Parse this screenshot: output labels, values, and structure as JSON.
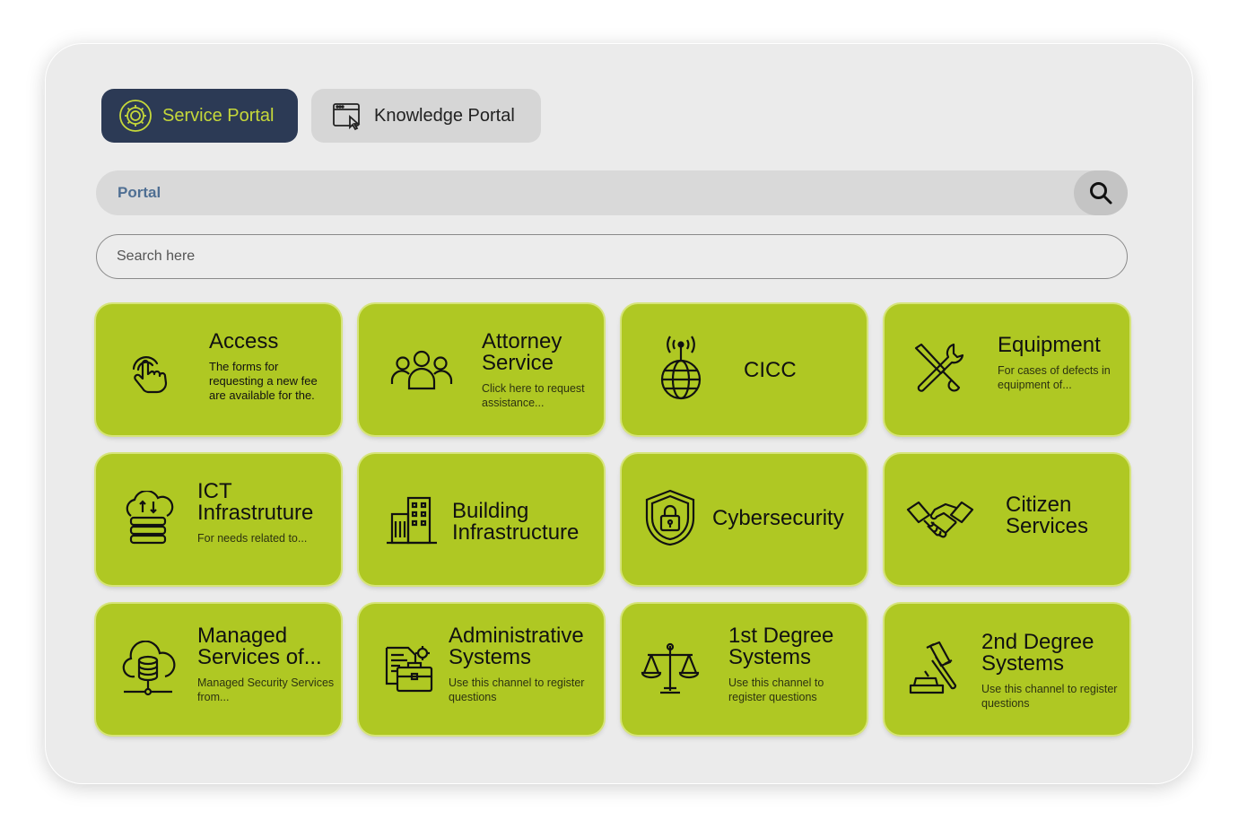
{
  "tabs": [
    {
      "label": "Service Portal",
      "icon": "gear-icon",
      "active": true
    },
    {
      "label": "Knowledge Portal",
      "icon": "browser-cursor-icon",
      "active": false
    }
  ],
  "portal_bar": {
    "label": "Portal",
    "search_icon": "search-icon"
  },
  "search": {
    "placeholder": "Search here"
  },
  "colors": {
    "accent": "#afc823",
    "navy": "#2c3a55",
    "lime_text": "#c6d83a"
  },
  "cards": [
    {
      "title": "Access",
      "desc": "The forms for requesting a new fee are available for the.",
      "icon": "touch-hand-icon"
    },
    {
      "title": "Attorney Service",
      "desc": "Click here to request assistance...",
      "icon": "people-group-icon"
    },
    {
      "title": "CICC",
      "desc": "",
      "icon": "globe-antenna-icon"
    },
    {
      "title": "Equipment",
      "desc": "For cases of defects in equipment of...",
      "icon": "tools-icon"
    },
    {
      "title": "ICT Infrastruture",
      "desc": "For needs related to...",
      "icon": "cloud-server-icon"
    },
    {
      "title": "Building Infrastructure",
      "desc": "",
      "icon": "building-icon"
    },
    {
      "title": "Cybersecurity",
      "desc": "",
      "icon": "shield-lock-icon"
    },
    {
      "title": "Citizen Services",
      "desc": "",
      "icon": "handshake-icon"
    },
    {
      "title": "Managed Services of...",
      "desc": "Managed Security Services from...",
      "icon": "cloud-database-icon"
    },
    {
      "title": "Administrative Systems",
      "desc": "Use this channel to register questions",
      "icon": "briefcase-docs-icon"
    },
    {
      "title": "1st Degree Systems",
      "desc": "Use this channel to register questions",
      "icon": "scales-icon"
    },
    {
      "title": "2nd Degree Systems",
      "desc": "Use this channel to register questions",
      "icon": "gavel-icon"
    }
  ]
}
